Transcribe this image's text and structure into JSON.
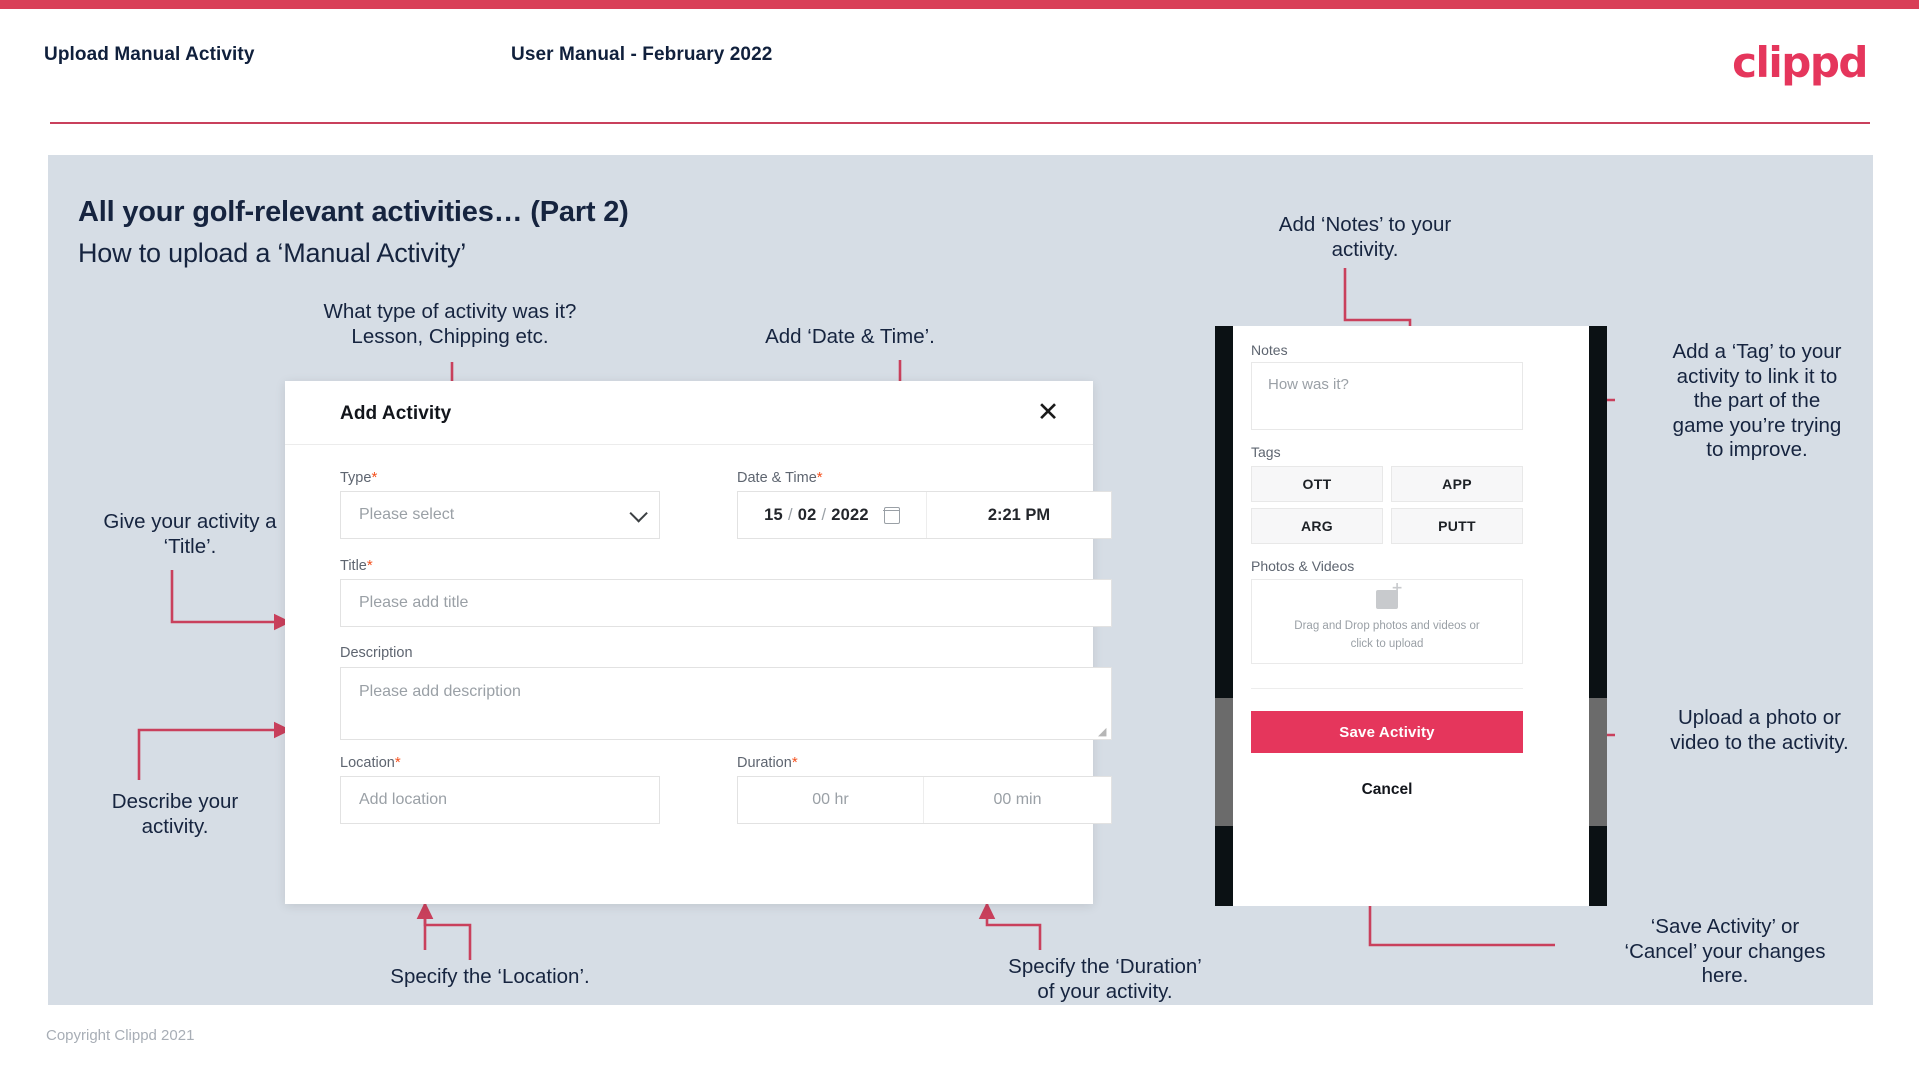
{
  "header": {
    "title": "Upload Manual Activity",
    "subtitle": "User Manual - February 2022",
    "brand": "clippd"
  },
  "slide": {
    "title": "All your golf-relevant activities… (Part 2)",
    "subtitle": "How to upload a ‘Manual Activity’"
  },
  "modal": {
    "title": "Add Activity",
    "close_icon": "✕",
    "fields": {
      "type": {
        "label": "Type",
        "required": "*",
        "placeholder": "Please select"
      },
      "datetime": {
        "label": "Date & Time",
        "required": "*",
        "day": "15",
        "month": "02",
        "year": "2022",
        "sep": "/",
        "time": "2:21 PM"
      },
      "title": {
        "label": "Title",
        "required": "*",
        "placeholder": "Please add title"
      },
      "description": {
        "label": "Description",
        "placeholder": "Please add description"
      },
      "location": {
        "label": "Location",
        "required": "*",
        "placeholder": "Add location"
      },
      "duration": {
        "label": "Duration",
        "required": "*",
        "hours": "00 hr",
        "minutes": "00 min"
      }
    }
  },
  "phone": {
    "notes": {
      "label": "Notes",
      "placeholder": "How was it?"
    },
    "tags": {
      "label": "Tags",
      "items": [
        "OTT",
        "APP",
        "ARG",
        "PUTT"
      ]
    },
    "media": {
      "label": "Photos & Videos",
      "upload_line1": "Drag and Drop photos and videos or",
      "upload_line2": "click to upload"
    },
    "save_label": "Save Activity",
    "cancel_label": "Cancel"
  },
  "annotations": {
    "type": "What type of activity was it?\nLesson, Chipping etc.",
    "datetime": "Add ‘Date & Time’.",
    "title": "Give your activity a\n‘Title’.",
    "description": "Describe your\nactivity.",
    "location": "Specify the ‘Location’.",
    "duration": "Specify the ‘Duration’\nof your activity.",
    "notes": "Add ‘Notes’ to your\nactivity.",
    "tags": "Add a ‘Tag’ to your\nactivity to link it to\nthe part of the\ngame you’re trying\nto improve.",
    "media": "Upload a photo or\nvideo to the activity.",
    "save": "‘Save Activity’ or\n‘Cancel’ your changes\nhere."
  },
  "footer": {
    "copyright": "Copyright Clippd 2021"
  },
  "colors": {
    "accent": "#e5365c",
    "bar": "#d94058",
    "rule": "#c9405c",
    "slide_bg": "#d6dde5",
    "arrow": "#c9405c",
    "text_dark": "#16243f"
  }
}
